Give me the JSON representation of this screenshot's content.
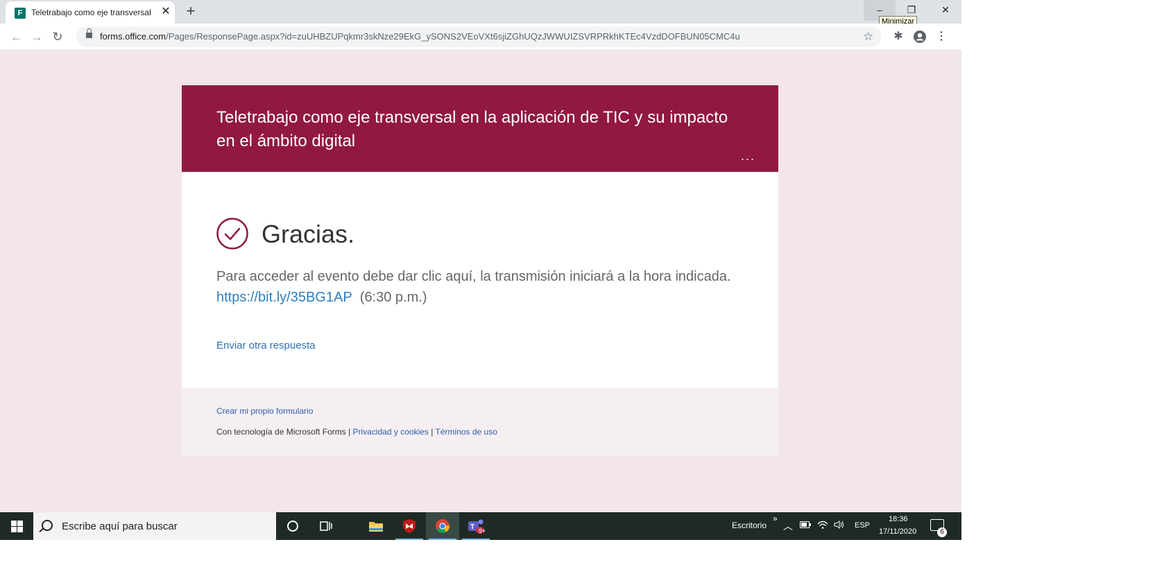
{
  "browser": {
    "tab_title": "Teletrabajo como eje transversal",
    "tab_favicon_letter": "F",
    "url_host": "forms.office.com",
    "url_path": "/Pages/ResponsePage.aspx?id=zuUHBZUPqkmr3skNze29EkG_ySONS2VEoVXt6sjiZGhUQzJWWUIZSVRPRkhKTEc4VzdDOFBUN05CMC4u",
    "tooltip": "Minimizar"
  },
  "form": {
    "title": "Teletrabajo como eje transversal en la aplicación de TIC y su impacto en el ámbito digital",
    "more": "...",
    "thanks": "Gracias.",
    "message": "Para acceder al evento debe dar clic aquí, la transmisión iniciará a la hora indicada.",
    "link": "https://bit.ly/35BG1AP",
    "time": "(6:30 p.m.)",
    "another_response": "Enviar otra respuesta",
    "accent_color": "#921844"
  },
  "footer": {
    "create": "Crear mi propio formulario",
    "powered": "Con tecnología de Microsoft Forms |",
    "privacy": "Privacidad y cookies",
    "sep": "|",
    "terms": "Términos de uso"
  },
  "taskbar": {
    "search_placeholder": "Escribe aquí para buscar",
    "desktop": "Escritorio",
    "chevrons": "»",
    "lang": "ESP",
    "time": "18:36",
    "date": "17/11/2020",
    "notifications": "6",
    "teams_badge": "9+"
  }
}
